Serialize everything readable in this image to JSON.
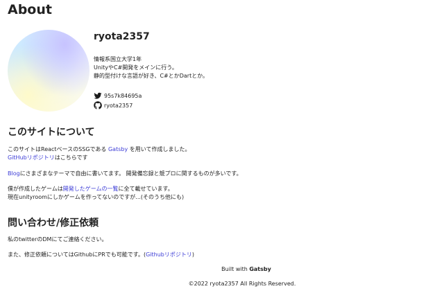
{
  "page": {
    "title": "About"
  },
  "profile": {
    "name": "ryota2357",
    "bio": [
      "情報系国立大学1年",
      "UnityやC#開発をメインに行う。",
      "静的型付けな言語が好き、C#とかDartとか。"
    ],
    "twitter": "95s7k84695a",
    "github": "ryota2357"
  },
  "about": {
    "heading": "このサイトについて",
    "p1_before": "このサイトはReactベースのSSGである ",
    "p1_link": "Gatsby",
    "p1_after": " を用いて作成しました。",
    "p2_link": "GitHubリポジトリ",
    "p2_after": "はこちらです",
    "p3_link": "Blog",
    "p3_after": "にさまざまなテーマで自由に書いてます。 開発備忘録と競プロに関するものが多いです。",
    "p4_before": "僕が作成したゲームは",
    "p4_link": "開発したゲームの一覧",
    "p4_after": "に全て載せています。",
    "p5": "現在unityroomにしかゲームを作ってないのですが...(そのうち他にも)"
  },
  "contact": {
    "heading": "問い合わせ/修正依頼",
    "p1": "私のtwitterのDMにてご連絡ください。",
    "p2_before": "また、修正依頼についてはGithubにPRでも可能です。(",
    "p2_link": "Githubリポジトリ",
    "p2_after": ")"
  },
  "footer": {
    "built_with": "Built with",
    "built_with_brand": "Gatsby",
    "copyright": "©2022 ryota2357 All Rights Reserved."
  },
  "icons": {
    "twitter": "twitter-icon",
    "github": "github-icon"
  },
  "colors": {
    "link": "#3b3bd6",
    "text": "#222222",
    "twitter": "#1a1a1a"
  }
}
